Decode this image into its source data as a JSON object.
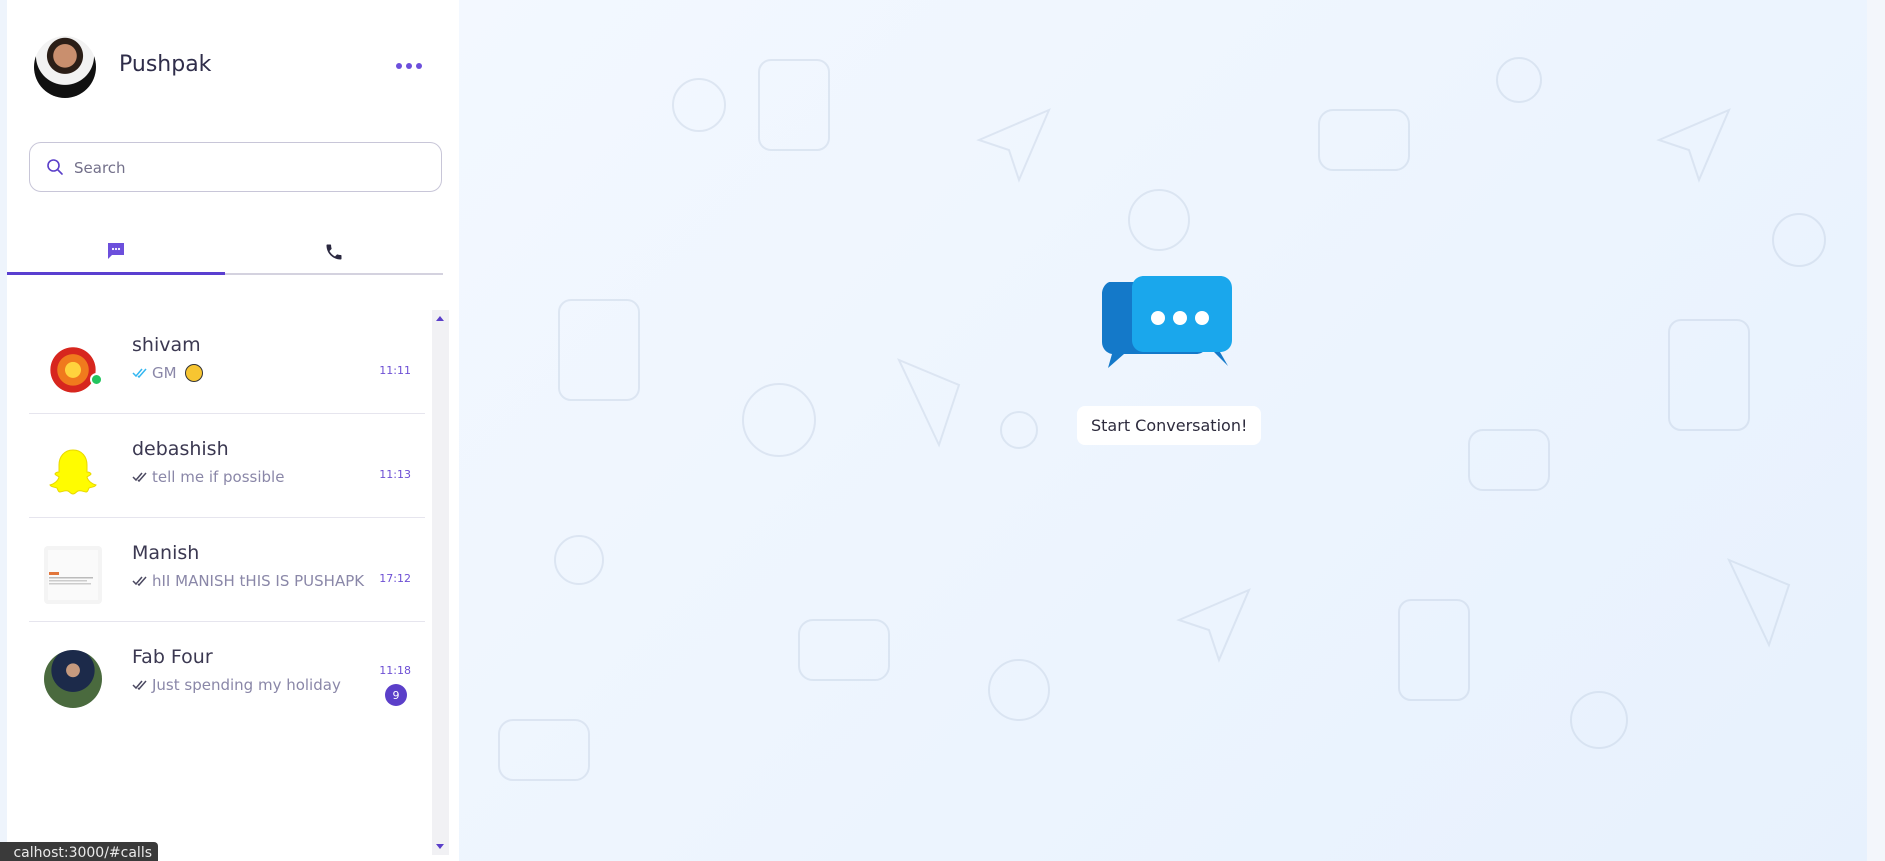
{
  "profile": {
    "name": "Pushpak"
  },
  "search": {
    "placeholder": "Search"
  },
  "tabs": [
    {
      "icon": "chat-icon",
      "active": true
    },
    {
      "icon": "phone-icon",
      "active": false
    }
  ],
  "chats": [
    {
      "name": "shivam",
      "preview": "GM",
      "time": "11:11",
      "online": true,
      "emoji": true
    },
    {
      "name": "debashish",
      "preview": "tell me if possible",
      "time": "11:13"
    },
    {
      "name": "Manish",
      "preview": "hII MANISH tHIS IS PUSHAPK",
      "time": "17:12"
    },
    {
      "name": "Fab Four",
      "preview": "Just spending my holiday",
      "time": "11:18",
      "unread": "9"
    }
  ],
  "main": {
    "empty_label": "Start Conversation!"
  },
  "status_bar": {
    "url": "calhost:3000/#calls"
  },
  "colors": {
    "accent": "#5b3fc9",
    "online": "#22c55e",
    "chat_bubble": "#1aa7ec"
  }
}
